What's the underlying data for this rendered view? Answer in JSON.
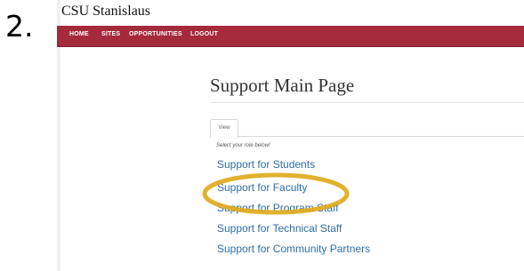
{
  "step": {
    "number": "2."
  },
  "site": {
    "title": "CSU Stanislaus"
  },
  "nav": {
    "items": [
      "HOME",
      "SITES",
      "OPPORTUNITIES",
      "LOGOUT"
    ]
  },
  "main": {
    "title": "Support Main Page",
    "tab_label": "View",
    "hint": "Select your role below!",
    "links": [
      "Support for Students",
      "Support for Faculty",
      "Support for Program Staff",
      "Support for Technical Staff",
      "Support for Community Partners"
    ]
  },
  "colors": {
    "navbar": "#a52a3c",
    "link": "#2e6da4",
    "highlight": "#e0a81a"
  }
}
